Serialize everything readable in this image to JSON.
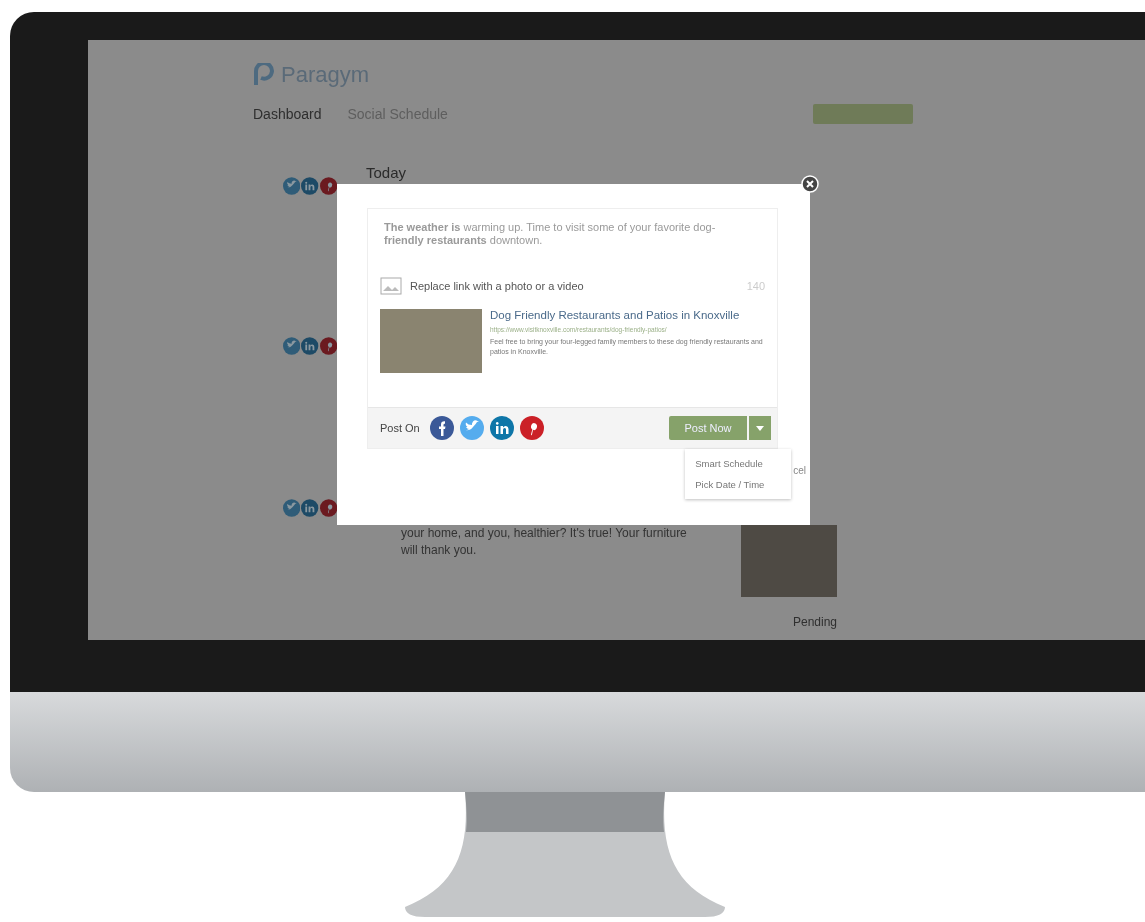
{
  "app": {
    "logo": "Paragym",
    "nav": [
      {
        "label": "Dashboard",
        "selected": true
      },
      {
        "label": "Social Schedule",
        "selected": false
      }
    ]
  },
  "schedule": {
    "day": "Today",
    "posts": [
      {
        "networks": [
          {
            "kind": "twitter"
          },
          {
            "kind": "linkedin"
          },
          {
            "kind": "pinterest"
          }
        ]
      },
      {
        "networks": [
          {
            "kind": "twitter"
          },
          {
            "kind": "linkedin"
          },
          {
            "kind": "pinterest"
          }
        ]
      },
      {
        "networks": [
          {
            "kind": "twitter"
          },
          {
            "kind": "linkedin"
          },
          {
            "kind": "pinterest"
          }
        ],
        "text": "your home, and you, healthier? It's true! Your furniture will thank you.",
        "status": "Pending"
      }
    ]
  },
  "modal": {
    "message": "**The weather is** warming up. Time to visit some of your favorite dog-**friendly restaurants** downtown.",
    "media_link": "Replace link with a photo or a video",
    "char_count": "140",
    "preview": {
      "title": "Dog Friendly Restaurants and Patios in Knoxville",
      "url": "https://www.visitknoxville.com/restaurants/dog-friendly-patios/",
      "description": "Feel free to bring your four-legged family members to these dog friendly restaurants and patios in Knoxville."
    },
    "post_on_label": "Post On",
    "networks": [
      {
        "kind": "facebook",
        "color": "#3b5998"
      },
      {
        "kind": "twitter",
        "color": "#55acee"
      },
      {
        "kind": "linkedin",
        "color": "#0e76a8"
      },
      {
        "kind": "pinterest",
        "color": "#cb2027"
      }
    ],
    "primary_button": "Post Now",
    "menu": [
      "Smart Schedule",
      "Pick Date / Time"
    ],
    "cancel_fragment": "cel"
  }
}
